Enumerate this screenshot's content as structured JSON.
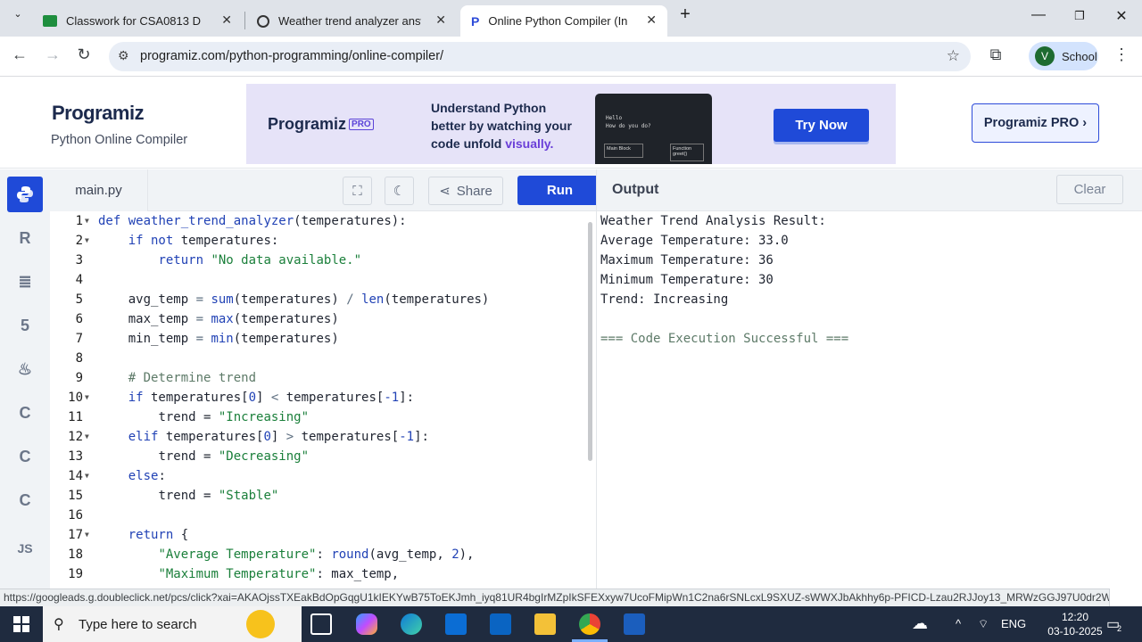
{
  "browser": {
    "tabs": [
      {
        "title": "Classwork for CSA0813 D",
        "active": false
      },
      {
        "title": "Weather trend analyzer answer",
        "active": false
      },
      {
        "title": "Online Python Compiler (Interp",
        "active": true
      }
    ],
    "url": "programiz.com/python-programming/online-compiler/",
    "profile_initial": "V",
    "profile_name": "School"
  },
  "header": {
    "logo": "Programiz",
    "subtitle": "Python Online Compiler",
    "banner": {
      "logo": "Programiz",
      "logo_badge": "PRO",
      "text_line1": "Understand Python",
      "text_line2": "better by watching your",
      "text_line3": "code unfold ",
      "text_highlight": "visually.",
      "demo_line1": "Hello",
      "demo_line2": "How do you do?",
      "demo_box1": "Main Block",
      "demo_box2": "Function greet()",
      "cta": "Try Now"
    },
    "pro_button": "Programiz PRO ›"
  },
  "editor": {
    "filename": "main.py",
    "share_label": "Share",
    "run_label": "Run",
    "lines": [
      {
        "n": "1",
        "fold": true
      },
      {
        "n": "2",
        "fold": true
      },
      {
        "n": "3",
        "fold": false
      },
      {
        "n": "4",
        "fold": false
      },
      {
        "n": "5",
        "fold": false
      },
      {
        "n": "6",
        "fold": false
      },
      {
        "n": "7",
        "fold": false
      },
      {
        "n": "8",
        "fold": false
      },
      {
        "n": "9",
        "fold": false
      },
      {
        "n": "10",
        "fold": true
      },
      {
        "n": "11",
        "fold": false
      },
      {
        "n": "12",
        "fold": true
      },
      {
        "n": "13",
        "fold": false
      },
      {
        "n": "14",
        "fold": true
      },
      {
        "n": "15",
        "fold": false
      },
      {
        "n": "16",
        "fold": false
      },
      {
        "n": "17",
        "fold": true
      },
      {
        "n": "18",
        "fold": false
      },
      {
        "n": "19",
        "fold": false
      }
    ],
    "code": {
      "l1_kw": "def",
      "l1_fn": "weather_trend_analyzer",
      "l1_rest": "(temperatures):",
      "l2_kw": "if not",
      "l2_rest": " temperatures:",
      "l3_kw": "return",
      "l3_str": "\"No data available.\"",
      "l5_a": "avg_temp",
      "l5_b": " = ",
      "l5_c": "sum",
      "l5_d": "(temperatures) ",
      "l5_e": "/",
      "l5_f": " ",
      "l5_g": "len",
      "l5_h": "(temperatures)",
      "l6_a": "max_temp",
      "l6_b": " = ",
      "l6_c": "max",
      "l6_d": "(temperatures)",
      "l7_a": "min_temp",
      "l7_b": " = ",
      "l7_c": "min",
      "l7_d": "(temperatures)",
      "l9": "# Determine trend",
      "l10_kw": "if",
      "l10_a": " temperatures[",
      "l10_n1": "0",
      "l10_b": "] ",
      "l10_op": "<",
      "l10_c": " temperatures[",
      "l10_n2": "-1",
      "l10_d": "]:",
      "l11_a": "trend = ",
      "l11_str": "\"Increasing\"",
      "l12_kw": "elif",
      "l12_a": " temperatures[",
      "l12_n1": "0",
      "l12_b": "] ",
      "l12_op": ">",
      "l12_c": " temperatures[",
      "l12_n2": "-1",
      "l12_d": "]:",
      "l13_a": "trend = ",
      "l13_str": "\"Decreasing\"",
      "l14_kw": "else",
      "l14_rest": ":",
      "l15_a": "trend = ",
      "l15_str": "\"Stable\"",
      "l17_kw": "return",
      "l17_rest": " {",
      "l18_str": "\"Average Temperature\"",
      "l18_a": ": ",
      "l18_fn": "round",
      "l18_b": "(avg_temp, ",
      "l18_n": "2",
      "l18_c": "),",
      "l19_str": "\"Maximum Temperature\"",
      "l19_a": ": max_temp,"
    }
  },
  "output": {
    "title": "Output",
    "clear_label": "Clear",
    "lines": [
      "Weather Trend Analysis Result:",
      "Average Temperature: 33.0",
      "Maximum Temperature: 36",
      "Minimum Temperature: 30",
      "Trend: Increasing",
      "",
      "=== Code Execution Successful ==="
    ]
  },
  "sidebar": {
    "items": [
      "python-icon",
      "r-icon",
      "sql-icon",
      "html-icon",
      "java-icon",
      "c-icon",
      "cpp-icon",
      "csharp-icon",
      "JS"
    ]
  },
  "status_url": "https://googleads.g.doubleclick.net/pcs/click?xai=AKAOjssTXEakBdOpGqgU1kIEKYwB75ToEKJmh_iyq81UR4bgIrMZpIkSFEXxyw7UcoFMipWn1C2na6rSNLcxL9SXUZ-sWWXJbAkhhy6p-PFICD-Lzau2RJJoy13_MRWzGGJ97U0dr2WLn7qkw...",
  "taskbar": {
    "search_placeholder": "Type here to search",
    "lang": "ENG",
    "time": "12:20",
    "date": "03-10-2025",
    "notifications": "2"
  },
  "colors": {
    "accent": "#1f4ad8",
    "sidebar_bg": "#f0f3f6",
    "taskbar_bg": "#1f2b3f"
  }
}
